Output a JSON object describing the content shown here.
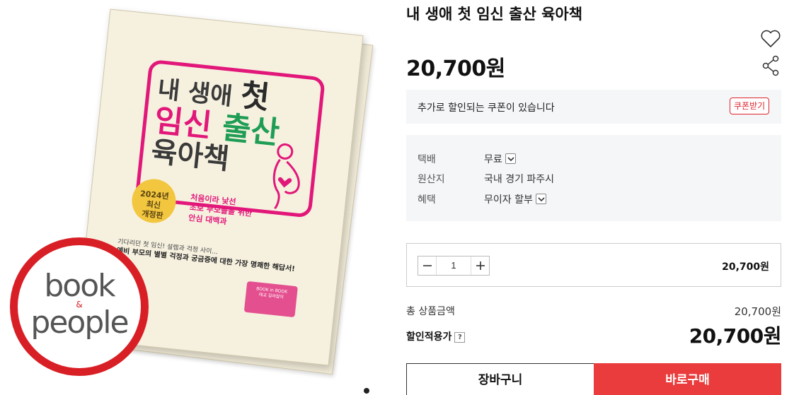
{
  "product": {
    "title": "내 생애 첫 임신 출산 육아책",
    "price": "20,700원"
  },
  "book_cover": {
    "title_line1_a": "내 생애 ",
    "title_line1_b": "첫",
    "title_line2_a": "임신 ",
    "title_line2_b": "출산",
    "title_line3": "육아책",
    "badge_line1": "2024년",
    "badge_line2": "최신",
    "badge_line3": "개정판",
    "subtitle_line1": "처음이라 낯선",
    "subtitle_line2": "초보 부모들을 위한",
    "subtitle_line3": "안심 대백과",
    "tagline_line1": "기다리던 첫 임신! 설렘과 걱정 사이...",
    "tagline_strong": "예비 부모의 별별 걱정과 궁금증에 대한 가장 명쾌한 해답서!",
    "sticker_line1": "BOOK in BOOK",
    "sticker_line2": "태교 길라잡이",
    "colors": {
      "pink": "#e2177a",
      "green": "#1f9d55",
      "badge": "#f2c63f"
    }
  },
  "logo": {
    "word1": "book",
    "amp": "&",
    "word2": "people",
    "ring_color": "#d81f26"
  },
  "icons": {
    "wishlist": "heart-outline-icon",
    "share": "share-icon"
  },
  "coupon": {
    "message": "추가로 할인되는 쿠폰이 있습니다",
    "button_label": "쿠폰받기"
  },
  "info": {
    "rows": [
      {
        "label": "택배",
        "value": "무료",
        "has_dropdown": true
      },
      {
        "label": "원산지",
        "value": "국내 경기 파주시",
        "has_dropdown": false
      },
      {
        "label": "혜택",
        "value": "무이자 할부",
        "has_dropdown": true
      }
    ]
  },
  "quantity": {
    "value": "1",
    "line_price": "20,700원"
  },
  "summary": {
    "total_label": "총 상품금액",
    "total_value": "20,700원",
    "discount_label": "할인적용가",
    "help_symbol": "?",
    "final_price": "20,700원"
  },
  "actions": {
    "cart_label": "장바구니",
    "buy_label": "바로구매",
    "buy_color": "#ea3c3c"
  }
}
